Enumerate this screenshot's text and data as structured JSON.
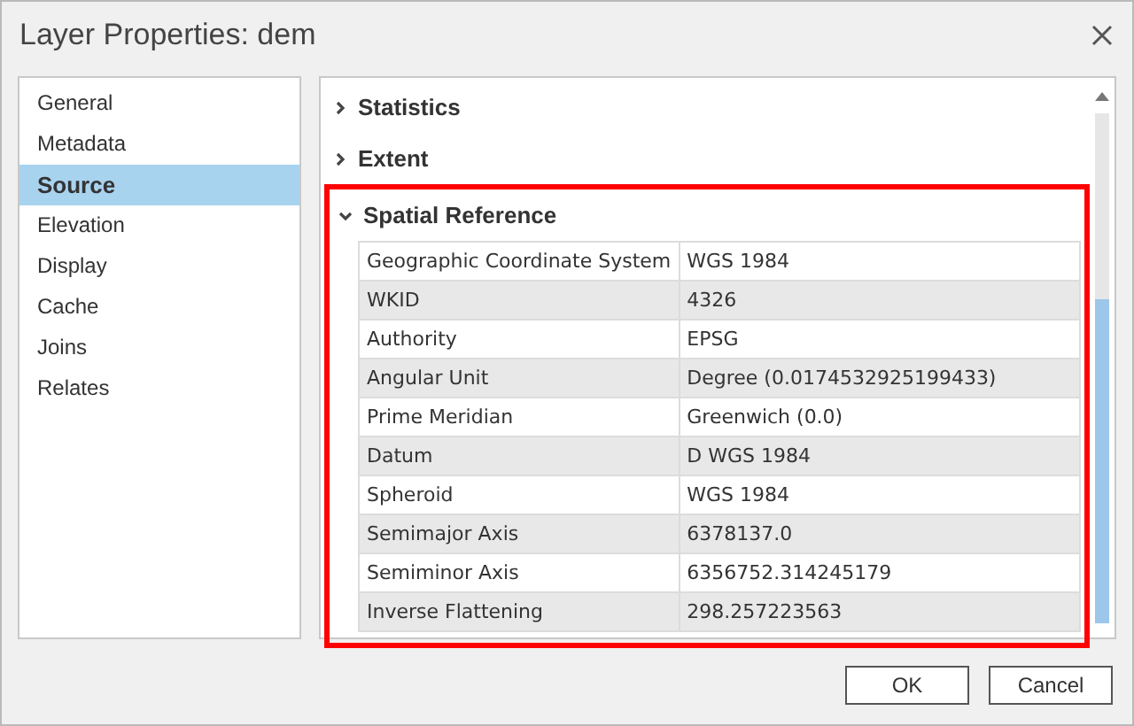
{
  "window": {
    "title": "Layer Properties: dem"
  },
  "sidebar": {
    "items": [
      {
        "label": "General",
        "selected": false
      },
      {
        "label": "Metadata",
        "selected": false
      },
      {
        "label": "Source",
        "selected": true
      },
      {
        "label": "Elevation",
        "selected": false
      },
      {
        "label": "Display",
        "selected": false
      },
      {
        "label": "Cache",
        "selected": false
      },
      {
        "label": "Joins",
        "selected": false
      },
      {
        "label": "Relates",
        "selected": false
      }
    ]
  },
  "sections": [
    {
      "title": "Statistics",
      "expanded": false,
      "highlighted": false
    },
    {
      "title": "Extent",
      "expanded": false,
      "highlighted": false
    },
    {
      "title": "Spatial Reference",
      "expanded": true,
      "highlighted": true,
      "rows": [
        {
          "key": "Geographic Coordinate System",
          "value": "WGS 1984"
        },
        {
          "key": "WKID",
          "value": "4326"
        },
        {
          "key": "Authority",
          "value": "EPSG"
        },
        {
          "key": "Angular Unit",
          "value": "Degree (0.0174532925199433)"
        },
        {
          "key": "Prime Meridian",
          "value": "Greenwich (0.0)"
        },
        {
          "key": "Datum",
          "value": "D WGS 1984"
        },
        {
          "key": "Spheroid",
          "value": "WGS 1984"
        },
        {
          "key": "Semimajor Axis",
          "value": "6378137.0"
        },
        {
          "key": "Semiminor Axis",
          "value": "6356752.314245179"
        },
        {
          "key": "Inverse Flattening",
          "value": "298.257223563"
        }
      ]
    }
  ],
  "buttons": [
    "OK",
    "Cancel"
  ]
}
